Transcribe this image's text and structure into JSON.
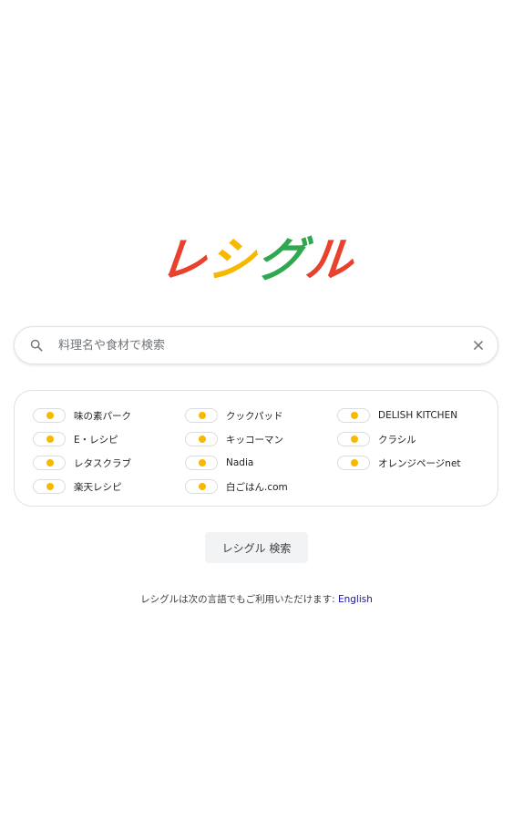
{
  "logo": {
    "chars": [
      {
        "text": "レ",
        "color": "#e8412c"
      },
      {
        "text": "シ",
        "color": "#f9b800"
      },
      {
        "text": "グ",
        "color": "#2fa84f"
      },
      {
        "text": "ル",
        "color": "#e8412c"
      }
    ]
  },
  "search": {
    "placeholder": "料理名や食材で検索",
    "value": "",
    "search_icon": "search-icon",
    "clear_icon": "close-icon"
  },
  "sites": [
    {
      "label": "味の素パーク",
      "enabled": true
    },
    {
      "label": "クックパッド",
      "enabled": true
    },
    {
      "label": "DELISH KITCHEN",
      "enabled": true
    },
    {
      "label": "E・レシピ",
      "enabled": true
    },
    {
      "label": "キッコーマン",
      "enabled": true
    },
    {
      "label": "クラシル",
      "enabled": true
    },
    {
      "label": "レタスクラブ",
      "enabled": true
    },
    {
      "label": "Nadia",
      "enabled": true
    },
    {
      "label": "オレンジページnet",
      "enabled": true
    },
    {
      "label": "楽天レシピ",
      "enabled": true
    },
    {
      "label": "白ごはん.com",
      "enabled": true
    }
  ],
  "toggle_color": "#f9b800",
  "search_button_label": "レシグル 検索",
  "language": {
    "prefix": "レシグルは次の言語でもご利用いただけます: ",
    "link": "English"
  }
}
